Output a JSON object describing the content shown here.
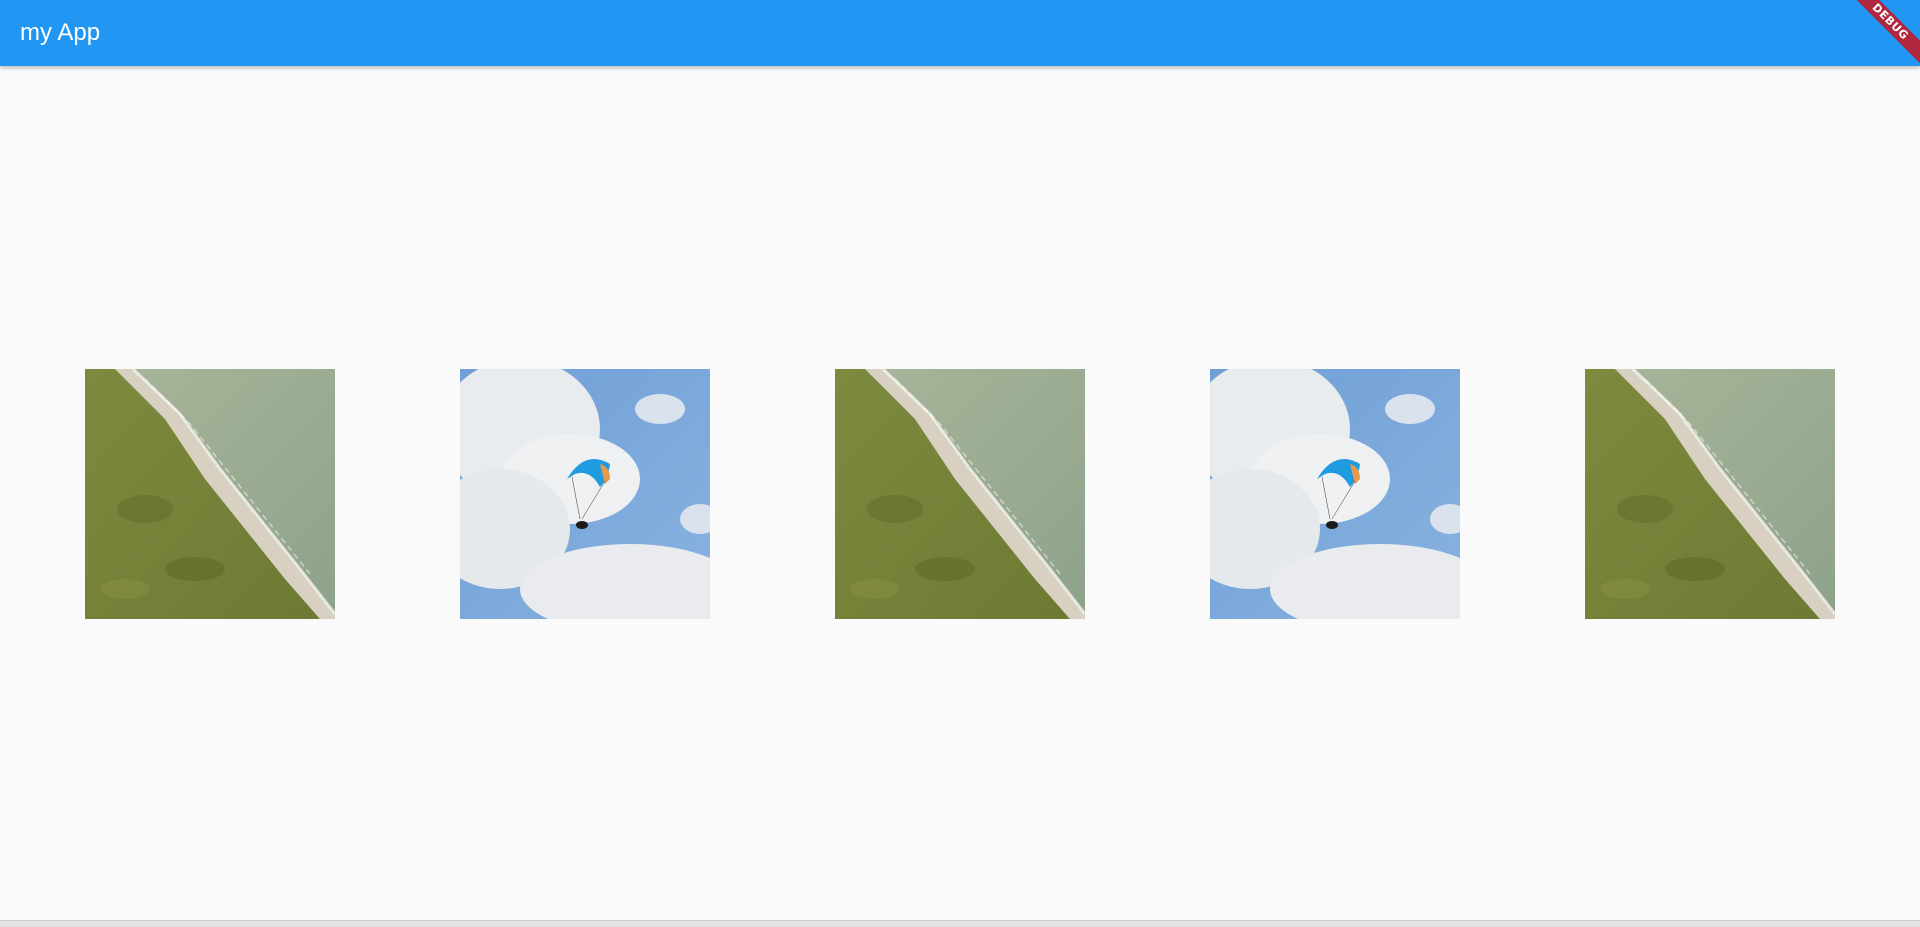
{
  "appbar": {
    "title": "my App",
    "color": "#2196f3"
  },
  "debug_banner": {
    "label": "DEBUG",
    "color": "#b0283f"
  },
  "gallery": {
    "items": [
      {
        "image": "coastline-aerial-photo"
      },
      {
        "image": "paraglider-sky-photo"
      },
      {
        "image": "coastline-aerial-photo"
      },
      {
        "image": "paraglider-sky-photo"
      },
      {
        "image": "coastline-aerial-photo"
      }
    ]
  }
}
